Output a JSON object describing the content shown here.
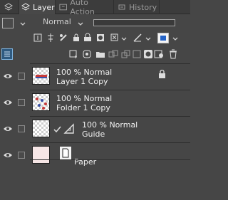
{
  "tabs": [
    {
      "label": "Layer",
      "icon": "layer-stack-icon",
      "active": true
    },
    {
      "label": "Auto Action",
      "icon": "auto-action-icon",
      "active": false
    },
    {
      "label": "History",
      "icon": "history-icon",
      "active": false
    }
  ],
  "blend_mode": "Normal",
  "layers": [
    {
      "opacity": "100 % Normal",
      "name": "Layer 1 Copy",
      "locked": true
    },
    {
      "opacity": "100 % Normal",
      "name": "Folder 1 Copy",
      "locked": false
    },
    {
      "opacity": "100 % Normal",
      "name": "Guide",
      "locked": false
    },
    {
      "opacity": "",
      "name": "Paper",
      "locked": false
    }
  ],
  "colors": {
    "accent": "#2f5a80",
    "panel": "#464646",
    "paper": "#f6e6e6"
  }
}
